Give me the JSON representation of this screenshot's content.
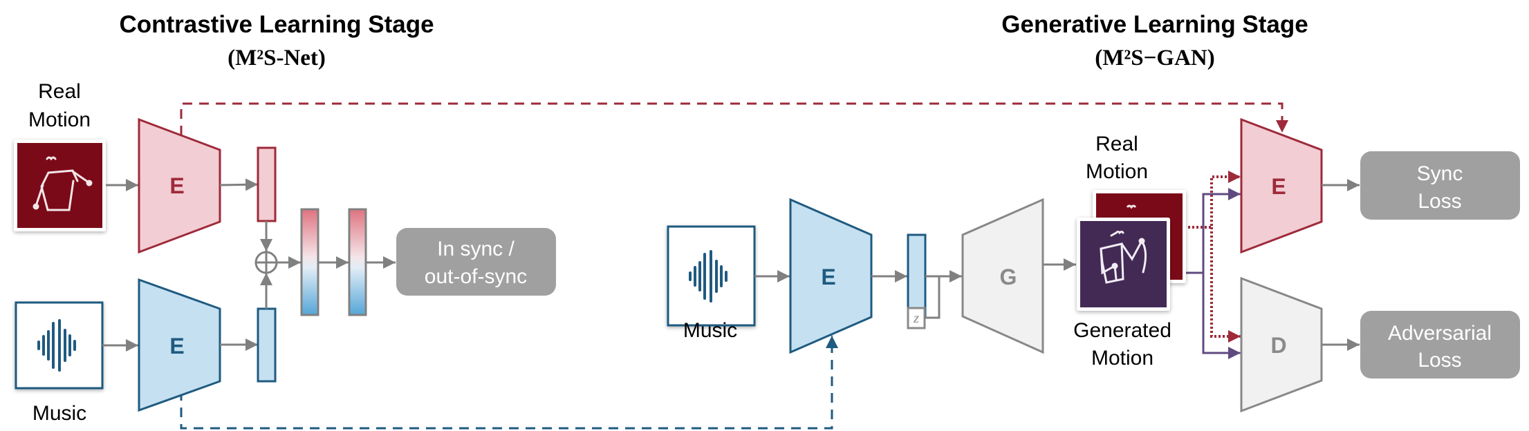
{
  "colors": {
    "red_stroke": "#9e2a3a",
    "red_fill": "#f2cdd3",
    "blue_stroke": "#1f5a80",
    "blue_fill": "#c5e0f1",
    "gray_stroke": "#888888",
    "gray_fill": "#f1f1f1",
    "loss_box": "#a0a0a0",
    "real_motion_bg": "#7b0a18",
    "generated_motion_bg": "#432a55",
    "purple_line": "#5f4a80",
    "arrow_gray": "#808080"
  },
  "contrastive": {
    "title": "Contrastive Learning Stage",
    "subtitle": "(M²S-Net)",
    "real_motion_label_1": "Real",
    "real_motion_label_2": "Motion",
    "music_label": "Music",
    "motion_encoder_letter": "E",
    "music_encoder_letter": "E",
    "output_line_1": "In sync /",
    "output_line_2": "out-of-sync"
  },
  "generative": {
    "title": "Generative Learning Stage",
    "subtitle": "(M²S−GAN)",
    "music_label": "Music",
    "music_encoder_letter": "E",
    "noise_symbol": "z",
    "generator_letter": "G",
    "real_motion_label_1": "Real",
    "real_motion_label_2": "Motion",
    "generated_motion_label_1": "Generated",
    "generated_motion_label_2": "Motion",
    "sync_encoder_letter": "E",
    "discriminator_letter": "D",
    "sync_loss_line_1": "Sync",
    "sync_loss_line_2": "Loss",
    "adv_loss_line_1": "Adversarial",
    "adv_loss_line_2": "Loss"
  }
}
